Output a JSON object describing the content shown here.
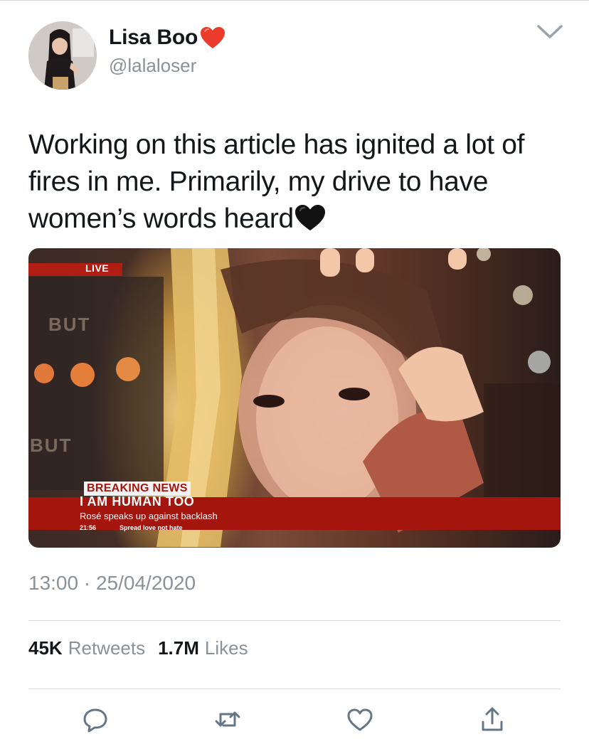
{
  "user": {
    "display_name": "Lisa Boo",
    "handle": "@lalaloser",
    "avatar_icon": "avatar-photo",
    "name_emoji_icon": "red-heart-icon"
  },
  "tweet": {
    "text": "Working on this article has ignited a lot of fires in me. Primarily, my drive to have women’s words heard",
    "trailing_emoji_icon": "black-heart-icon",
    "time": "13:00",
    "separator": "·",
    "date": "25/04/2020"
  },
  "media": {
    "live_label": "LIVE",
    "background_text_1": "BUT",
    "background_text_2": "BUT",
    "breaking_label": "BREAKING NEWS",
    "headline": "I AM HUMAN TOO",
    "subheadline": "Rosé speaks up against backlash",
    "ticker_time": "21:56",
    "ticker_text": "Spread love not hate"
  },
  "stats": {
    "retweets_count": "45K",
    "retweets_label": "Retweets",
    "likes_count": "1.7M",
    "likes_label": "Likes"
  },
  "actions": [
    "reply-icon",
    "retweet-icon",
    "like-icon",
    "share-icon"
  ],
  "colors": {
    "text_primary": "#14171a",
    "text_secondary": "#8a9199",
    "divider": "#d6d9db",
    "icon": "#657786",
    "news_red": "#a4150d"
  }
}
